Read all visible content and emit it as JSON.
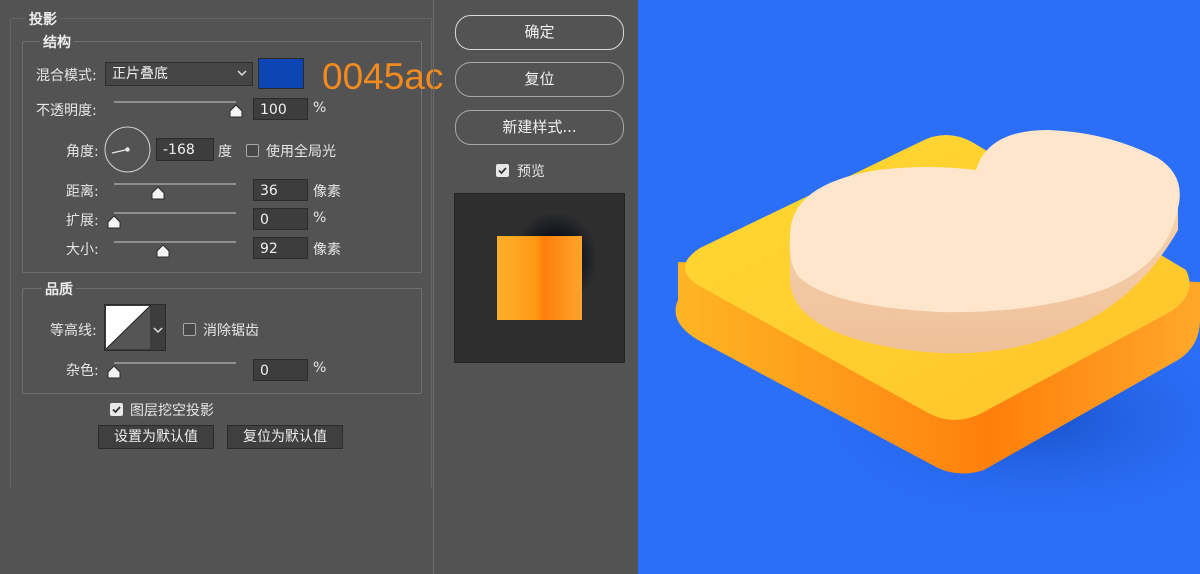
{
  "dialog": {
    "title": "投影",
    "structure": {
      "legend": "结构",
      "blend_mode_label": "混合模式:",
      "blend_mode_value": "正片叠底",
      "shadow_color": "#0b46b4",
      "opacity_label": "不透明度:",
      "opacity_value": "100",
      "opacity_unit": "%",
      "opacity_level": 1.0,
      "angle_label": "角度:",
      "angle_value": "-168",
      "angle_unit": "度",
      "global_light_label": "使用全局光",
      "global_light_checked": false,
      "distance_label": "距离:",
      "distance_value": "36",
      "distance_unit": "像素",
      "distance_level": 0.36,
      "spread_label": "扩展:",
      "spread_value": "0",
      "spread_unit": "%",
      "spread_level": 0.0,
      "size_label": "大小:",
      "size_value": "92",
      "size_unit": "像素",
      "size_level": 0.4
    },
    "quality": {
      "legend": "品质",
      "contour_label": "等高线:",
      "anti_alias_label": "消除锯齿",
      "anti_alias_checked": false,
      "noise_label": "杂色:",
      "noise_value": "0",
      "noise_unit": "%",
      "noise_level": 0.0
    },
    "knockout_label": "图层挖空投影",
    "knockout_checked": true,
    "set_default_label": "设置为默认值",
    "reset_default_label": "复位为默认值"
  },
  "side": {
    "ok_label": "确定",
    "reset_label": "复位",
    "new_style_label": "新建样式...",
    "preview_label": "预览",
    "preview_checked": true
  },
  "annotation": {
    "hex_text": "0045ac",
    "color": "#f38a1d"
  },
  "canvas": {
    "background": "#2b6ef8",
    "base_top_color": "#ffd22e",
    "base_side_color": "#ff8a12",
    "cloud_top_color": "#fde6cc",
    "cloud_side_color": "#f3c9a4"
  }
}
